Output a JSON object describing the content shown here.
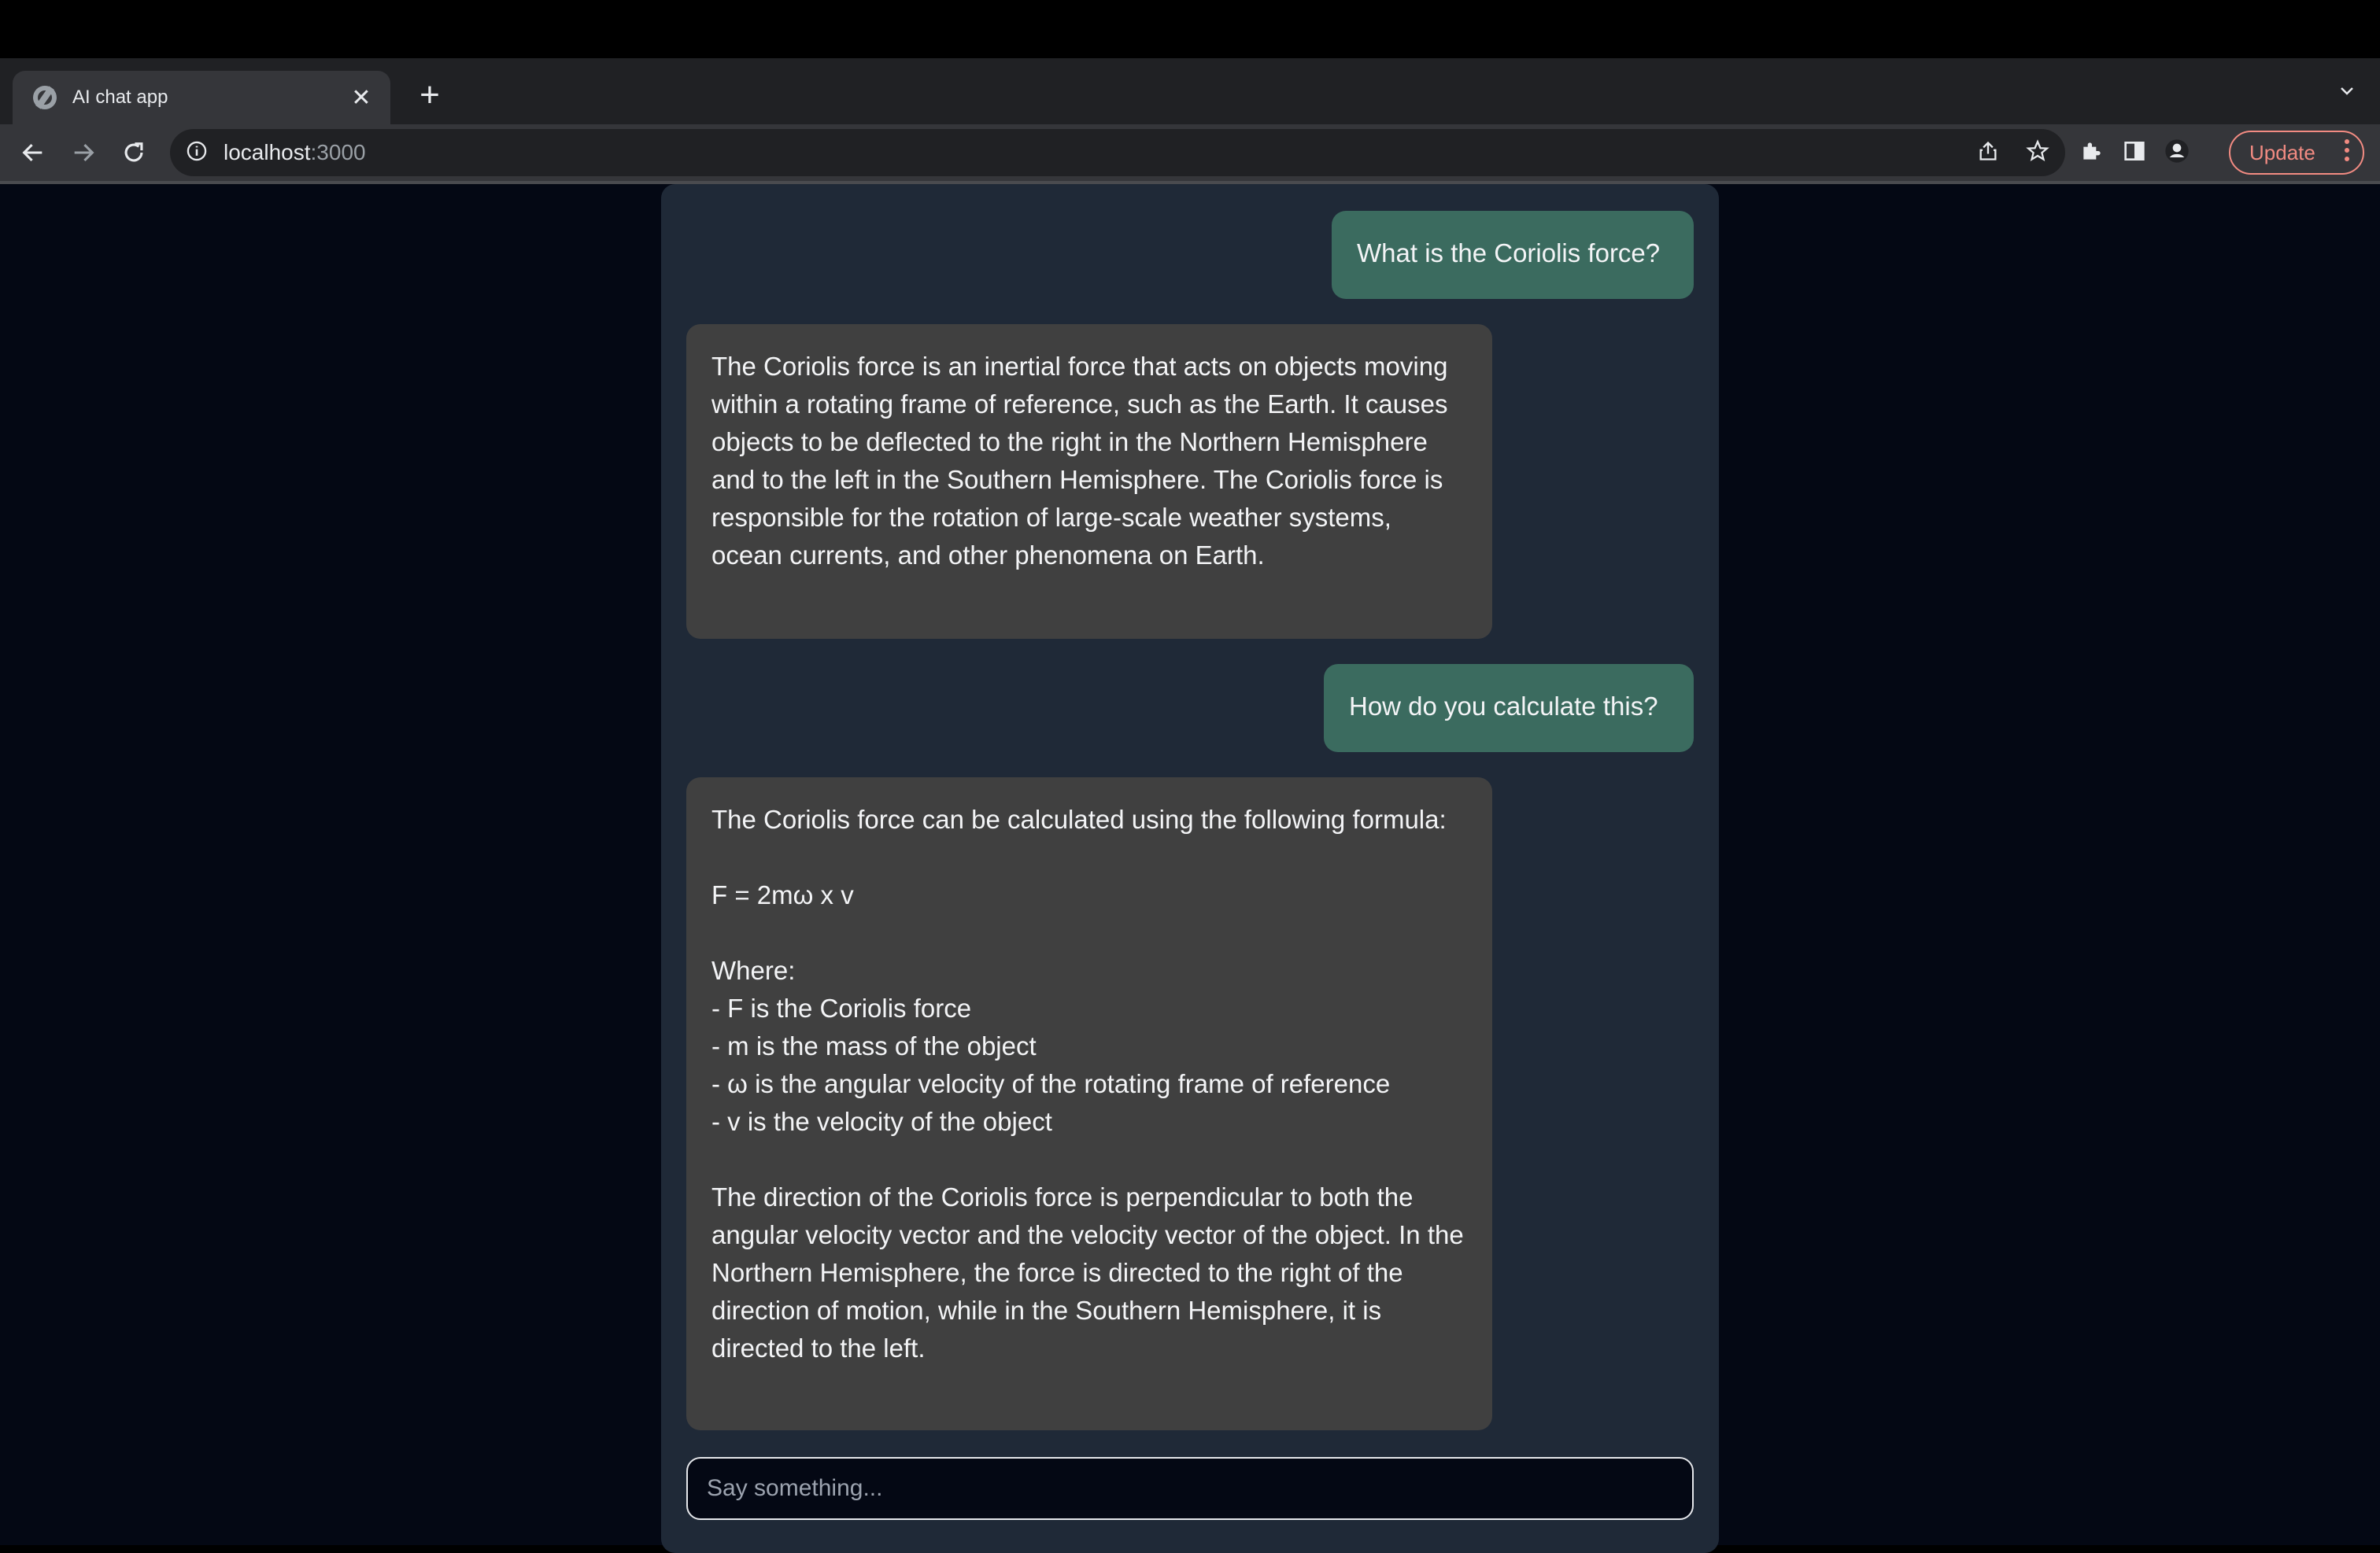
{
  "browser": {
    "tab_title": "AI chat app",
    "url_host": "localhost",
    "url_port": ":3000",
    "update_label": "Update"
  },
  "chat": {
    "messages": [
      {
        "role": "user",
        "text": "What is the Coriolis force?"
      },
      {
        "role": "assistant",
        "text": "The Coriolis force is an inertial force that acts on objects moving within a rotating frame of reference, such as the Earth. It causes objects to be deflected to the right in the Northern Hemisphere and to the left in the Southern Hemisphere. The Coriolis force is responsible for the rotation of large-scale weather systems, ocean currents, and other phenomena on Earth."
      },
      {
        "role": "user",
        "text": "How do you calculate this?"
      },
      {
        "role": "assistant",
        "text": "The Coriolis force can be calculated using the following formula:\n\nF = 2mω x v\n\nWhere:\n- F is the Coriolis force\n- m is the mass of the object\n- ω is the angular velocity of the rotating frame of reference\n- v is the velocity of the object\n\nThe direction of the Coriolis force is perpendicular to both the angular velocity vector and the velocity vector of the object. In the Northern Hemisphere, the force is directed to the right of the direction of motion, while in the Southern Hemisphere, it is directed to the left."
      }
    ],
    "input_placeholder": "Say something..."
  },
  "colors": {
    "user_bubble": "#3b6b5f",
    "assistant_bubble": "#404040",
    "chat_panel": "#1f2937",
    "page_background": "#040814"
  }
}
